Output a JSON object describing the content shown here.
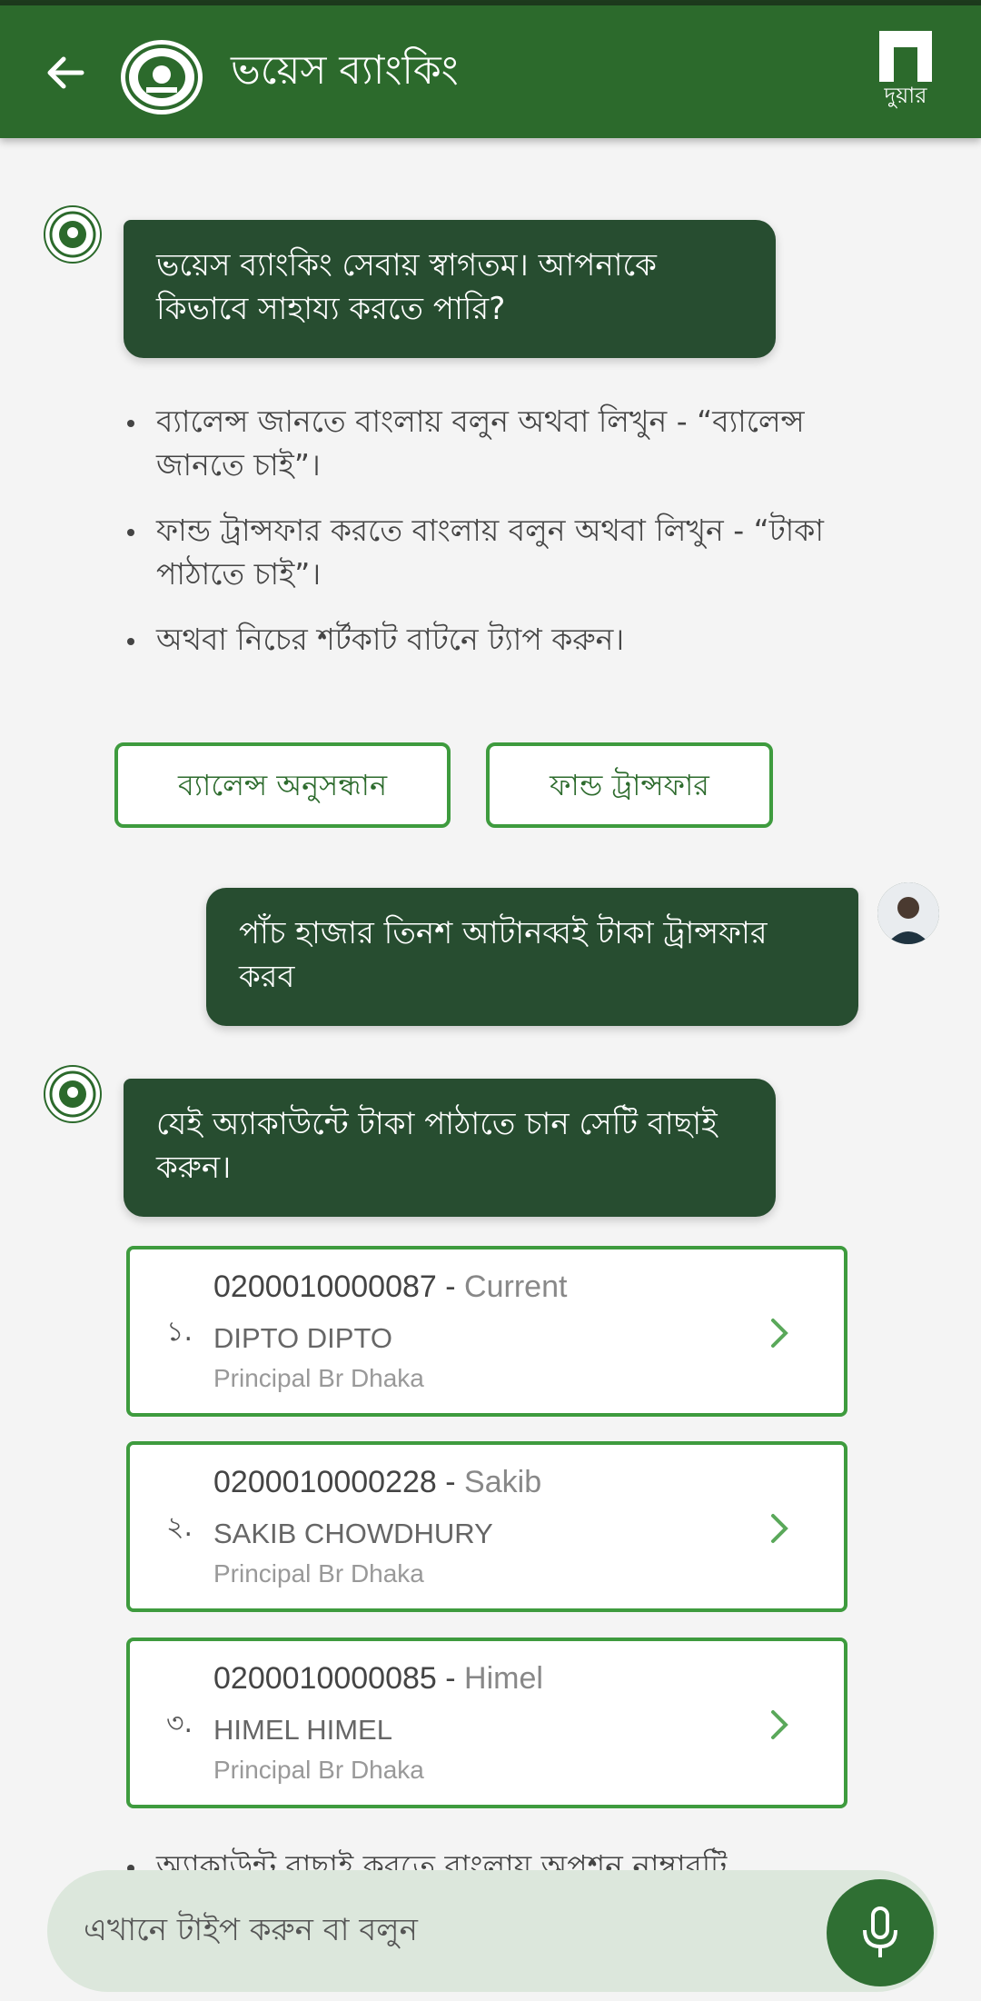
{
  "app": {
    "title": "ভয়েস ব্যাংকিং",
    "home_label": "দুয়ার"
  },
  "colors": {
    "header": "#2c6a2c",
    "bubble": "#274d30",
    "accent_border": "#3e9b3e",
    "input_bg": "#dce7dc"
  },
  "messages": {
    "welcome": "ভয়েস ব্যাংকিং সেবায়  স্বাগতম। আপনাকে কিভাবে সাহায্য করতে পারি?",
    "instructions": [
      "ব্যালেন্স জানতে বাংলায় বলুন অথবা লিখুন - “ব্যালেন্স জানতে চাই”।",
      "ফান্ড ট্রান্সফার করতে বাংলায় বলুন অথবা লিখুন - “টাকা পাঠাতে চাই”।",
      "অথবা নিচের শর্টকাট বাটনে ট্যাপ করুন।"
    ],
    "user_request": "পাঁচ হাজার তিনশ আটানব্বই টাকা ট্রান্সফার করব",
    "select_account": "যেই অ্যাকাউন্টে টাকা পাঠাতে চান সেটি বাছাই করুন।",
    "partial_instruction": "অ্যাকাউন্ট বাছাই করতে বাংলায় অপশন নাম্বারটি"
  },
  "shortcuts": {
    "balance": "ব্যালেন্স অনুসন্ধান",
    "transfer": "ফান্ড ট্রান্সফার"
  },
  "accounts": [
    {
      "index": "১.",
      "number": "0200010000087",
      "nickname": "Current",
      "name": "DIPTO DIPTO",
      "branch": "Principal Br Dhaka"
    },
    {
      "index": "২.",
      "number": "0200010000228",
      "nickname": "Sakib",
      "name": "SAKIB CHOWDHURY",
      "branch": "Principal Br Dhaka"
    },
    {
      "index": "৩.",
      "number": "0200010000085",
      "nickname": "Himel",
      "name": "HIMEL HIMEL",
      "branch": "Principal Br Dhaka"
    }
  ],
  "input": {
    "placeholder": "এখানে টাইপ করুন বা বলুন"
  }
}
